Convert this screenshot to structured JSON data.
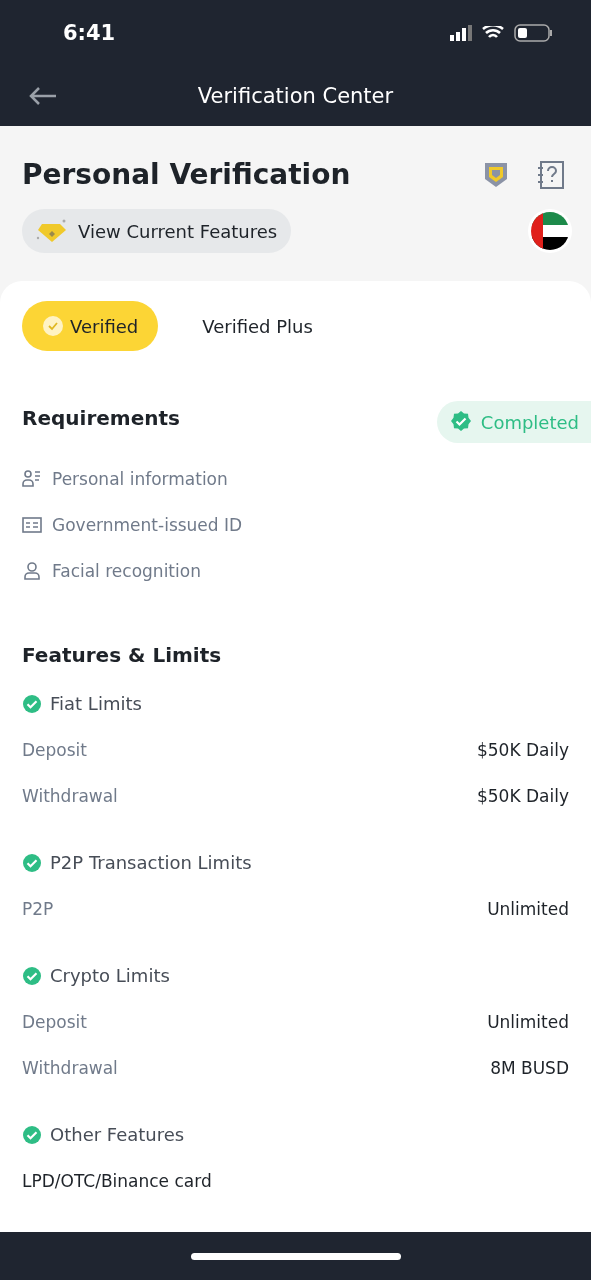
{
  "status_bar": {
    "time": "6:41"
  },
  "header": {
    "title": "Verification Center"
  },
  "hero": {
    "title": "Personal Verification",
    "features_button": "View Current Features"
  },
  "tabs": [
    {
      "label": "Verified",
      "selected": true
    },
    {
      "label": "Verified Plus",
      "selected": false
    }
  ],
  "requirements": {
    "title": "Requirements",
    "status": "Completed",
    "items": [
      {
        "kind": "info",
        "label": "Personal information"
      },
      {
        "kind": "id",
        "label": "Government-issued ID"
      },
      {
        "kind": "face",
        "label": "Facial recognition"
      }
    ]
  },
  "features": {
    "title": "Features & Limits",
    "groups": [
      {
        "title": "Fiat Limits",
        "rows": [
          {
            "kind": "limit",
            "label": "Deposit",
            "value": "$50K Daily"
          },
          {
            "kind": "limit",
            "label": "Withdrawal",
            "value": "$50K Daily"
          }
        ]
      },
      {
        "title": "P2P Transaction Limits",
        "rows": [
          {
            "kind": "limit",
            "label": "P2P",
            "value": "Unlimited"
          }
        ]
      },
      {
        "title": "Crypto Limits",
        "rows": [
          {
            "kind": "limit",
            "label": "Deposit",
            "value": "Unlimited"
          },
          {
            "kind": "limit",
            "label": "Withdrawal",
            "value": "8M BUSD"
          }
        ]
      },
      {
        "title": "Other Features",
        "rows": [
          {
            "kind": "feature",
            "label": "LPD/OTC/Binance card"
          }
        ]
      }
    ]
  }
}
